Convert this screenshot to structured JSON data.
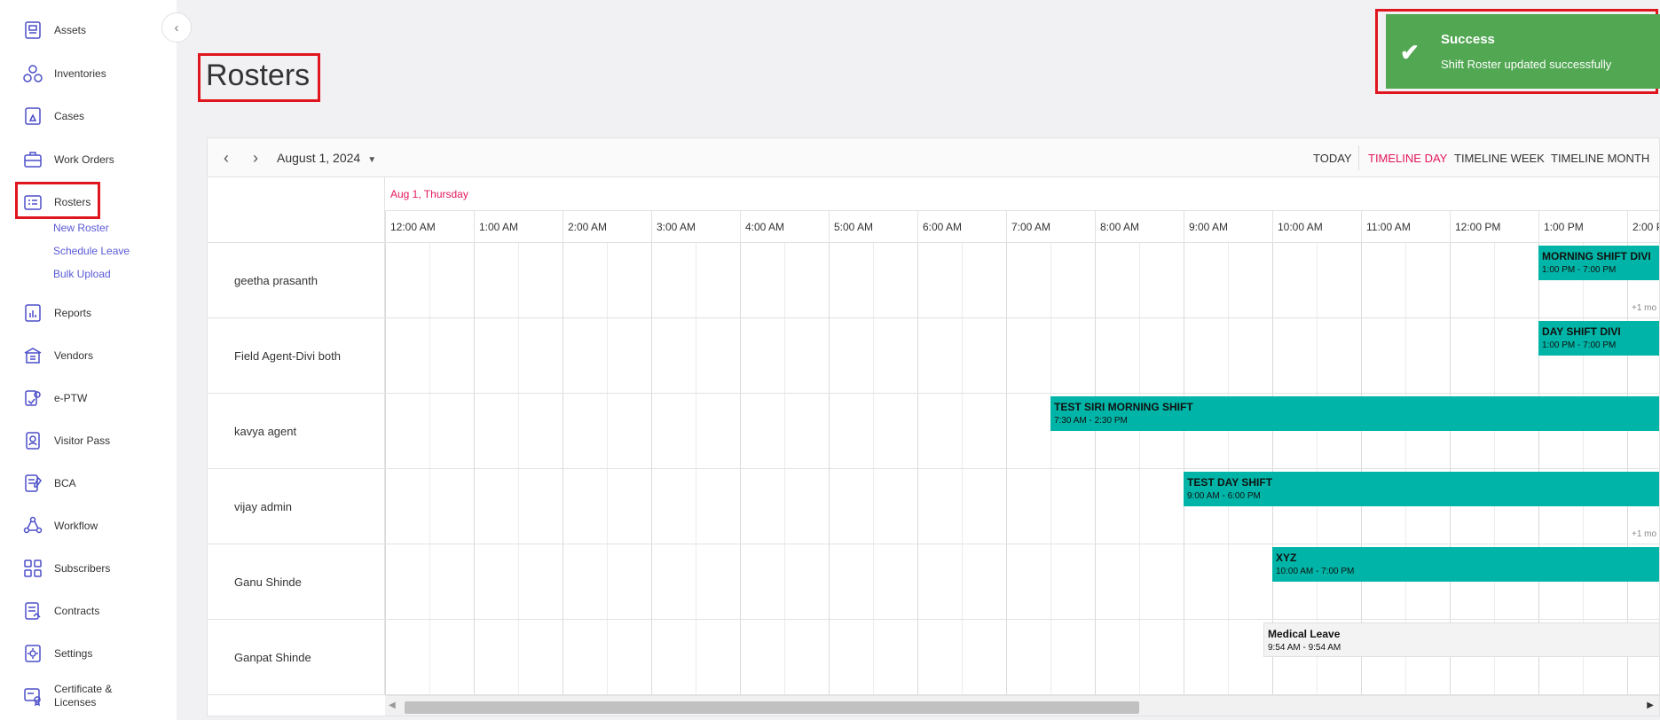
{
  "sidebar": {
    "items": [
      {
        "label": "Assets",
        "icon": "assets-icon"
      },
      {
        "label": "Inventories",
        "icon": "inventories-icon"
      },
      {
        "label": "Cases",
        "icon": "cases-icon"
      },
      {
        "label": "Work Orders",
        "icon": "work-orders-icon"
      },
      {
        "label": "Rosters",
        "icon": "rosters-icon"
      },
      {
        "label": "Reports",
        "icon": "reports-icon"
      },
      {
        "label": "Vendors",
        "icon": "vendors-icon"
      },
      {
        "label": "e-PTW",
        "icon": "eptw-icon"
      },
      {
        "label": "Visitor Pass",
        "icon": "visitor-pass-icon"
      },
      {
        "label": "BCA",
        "icon": "bca-icon"
      },
      {
        "label": "Workflow",
        "icon": "workflow-icon"
      },
      {
        "label": "Subscribers",
        "icon": "subscribers-icon"
      },
      {
        "label": "Contracts",
        "icon": "contracts-icon"
      },
      {
        "label": "Settings",
        "icon": "settings-icon"
      },
      {
        "label": "Certificate &\nLicenses",
        "icon": "certificate-icon"
      }
    ],
    "sub_items": [
      "New Roster",
      "Schedule Leave",
      "Bulk Upload"
    ]
  },
  "page": {
    "title": "Rosters"
  },
  "toast": {
    "title": "Success",
    "message": "Shift Roster updated successfully",
    "color": "#52a753"
  },
  "scheduler": {
    "date": "August 1, 2024",
    "views": [
      "TODAY",
      "TIMELINE DAY",
      "TIMELINE WEEK",
      "TIMELINE MONTH"
    ],
    "active_view": "TIMELINE DAY",
    "date_header": "Aug 1, Thursday",
    "hours": [
      "12:00 AM",
      "1:00 AM",
      "2:00 AM",
      "3:00 AM",
      "4:00 AM",
      "5:00 AM",
      "6:00 AM",
      "7:00 AM",
      "8:00 AM",
      "9:00 AM",
      "10:00 AM",
      "11:00 AM",
      "12:00 PM",
      "1:00 PM",
      "2:00 PM"
    ],
    "resources": [
      "geetha prasanth",
      "Field Agent-Divi both",
      "kavya agent",
      "vijay admin",
      "Ganu Shinde",
      "Ganpat Shinde"
    ],
    "events": [
      {
        "title": "MORNING SHIFT DIVI",
        "time": "1:00 PM - 7:00 PM",
        "type": "shift"
      },
      {
        "title": "DAY SHIFT DIVI",
        "time": "1:00 PM - 7:00 PM",
        "type": "shift"
      },
      {
        "title": "TEST SIRI MORNING SHIFT",
        "time": "7:30 AM - 2:30 PM",
        "type": "shift"
      },
      {
        "title": "TEST DAY SHIFT",
        "time": "9:00 AM - 6:00 PM",
        "type": "shift"
      },
      {
        "title": "XYZ",
        "time": "10:00 AM - 7:00 PM",
        "type": "shift"
      },
      {
        "title": "Medical Leave",
        "time": "9:54 AM - 9:54 AM",
        "type": "leave"
      }
    ],
    "more_label": "+1 mo",
    "event_color": "#00b5a7",
    "accent": "#e3165b"
  }
}
